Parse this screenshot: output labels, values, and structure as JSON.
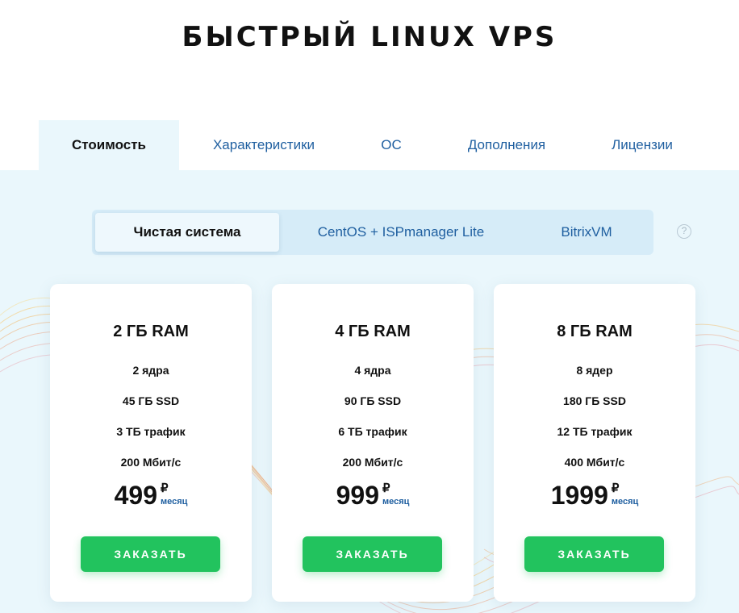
{
  "page": {
    "title": "БЫСТРЫЙ LINUX VPS"
  },
  "tabs": [
    {
      "label": "Стоимость",
      "active": true
    },
    {
      "label": "Характеристики",
      "active": false
    },
    {
      "label": "ОС",
      "active": false
    },
    {
      "label": "Дополнения",
      "active": false
    },
    {
      "label": "Лицензии",
      "active": false
    }
  ],
  "os_selector": {
    "options": [
      {
        "label": "Чистая система",
        "active": true
      },
      {
        "label": "CentOS + ISPmanager Lite",
        "active": false
      },
      {
        "label": "BitrixVM",
        "active": false
      }
    ],
    "help_icon": "question-circle-icon",
    "help_glyph": "?"
  },
  "plans": [
    {
      "name": "2 ГБ RAM",
      "cores": "2 ядра",
      "disk": "45 ГБ SSD",
      "traffic": "3 ТБ трафик",
      "speed": "200 Мбит/с",
      "price": "499",
      "currency": "₽",
      "period": "месяц",
      "button": "ЗАКАЗАТЬ"
    },
    {
      "name": "4 ГБ RAM",
      "cores": "4 ядра",
      "disk": "90 ГБ SSD",
      "traffic": "6 ТБ трафик",
      "speed": "200 Мбит/с",
      "price": "999",
      "currency": "₽",
      "period": "месяц",
      "button": "ЗАКАЗАТЬ"
    },
    {
      "name": "8 ГБ RAM",
      "cores": "8 ядер",
      "disk": "180 ГБ SSD",
      "traffic": "12 ТБ трафик",
      "speed": "400 Мбит/с",
      "price": "1999",
      "currency": "₽",
      "period": "месяц",
      "button": "ЗАКАЗАТЬ"
    }
  ],
  "colors": {
    "accent_green": "#22c35e",
    "link_blue": "#1f5fa0",
    "panel_bg": "#eaf7fc"
  }
}
